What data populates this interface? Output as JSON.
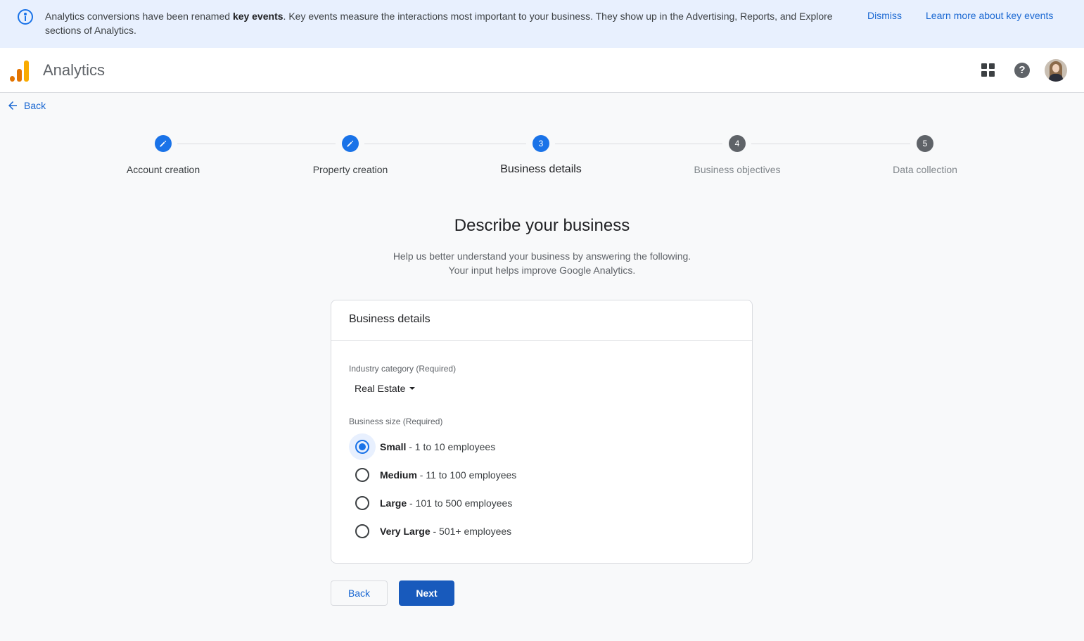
{
  "banner": {
    "text_before": "Analytics conversions have been renamed ",
    "text_bold": "key events",
    "text_after": ". Key events measure the interactions most important to your business. They show up in the Advertising, Reports, and Explore sections of Analytics.",
    "dismiss_label": "Dismiss",
    "learn_more_label": "Learn more about key events",
    "icon": "info-icon"
  },
  "header": {
    "app_title": "Analytics",
    "icons": [
      "analytics-logo-icon",
      "apps-grid-icon",
      "help-icon",
      "avatar"
    ]
  },
  "nav": {
    "back_label": "Back"
  },
  "stepper": {
    "steps": [
      {
        "number": "",
        "label": "Account creation",
        "state": "done",
        "icon": "edit-pencil-icon"
      },
      {
        "number": "",
        "label": "Property creation",
        "state": "done",
        "icon": "edit-pencil-icon"
      },
      {
        "number": "3",
        "label": "Business details",
        "state": "active"
      },
      {
        "number": "4",
        "label": "Business objectives",
        "state": "pending"
      },
      {
        "number": "5",
        "label": "Data collection",
        "state": "pending"
      }
    ]
  },
  "main": {
    "heading": "Describe your business",
    "subtitle_line1": "Help us better understand your business by answering the following.",
    "subtitle_line2": "Your input helps improve Google Analytics."
  },
  "card": {
    "title": "Business details",
    "industry_label": "Industry category (Required)",
    "industry_value": "Real Estate",
    "size_label": "Business size (Required)",
    "size_options": [
      {
        "name": "Small",
        "detail": " - 1 to 10 employees",
        "selected": true
      },
      {
        "name": "Medium",
        "detail": " - 11 to 100 employees",
        "selected": false
      },
      {
        "name": "Large",
        "detail": " - 101 to 500 employees",
        "selected": false
      },
      {
        "name": "Very Large",
        "detail": " - 501+ employees",
        "selected": false
      }
    ]
  },
  "footer": {
    "back_button": "Back",
    "next_button": "Next"
  },
  "colors": {
    "accent": "#1a73e8",
    "banner_bg": "#e8f0fe",
    "next_button_bg": "#185abc",
    "pending_step": "#5f6368"
  }
}
